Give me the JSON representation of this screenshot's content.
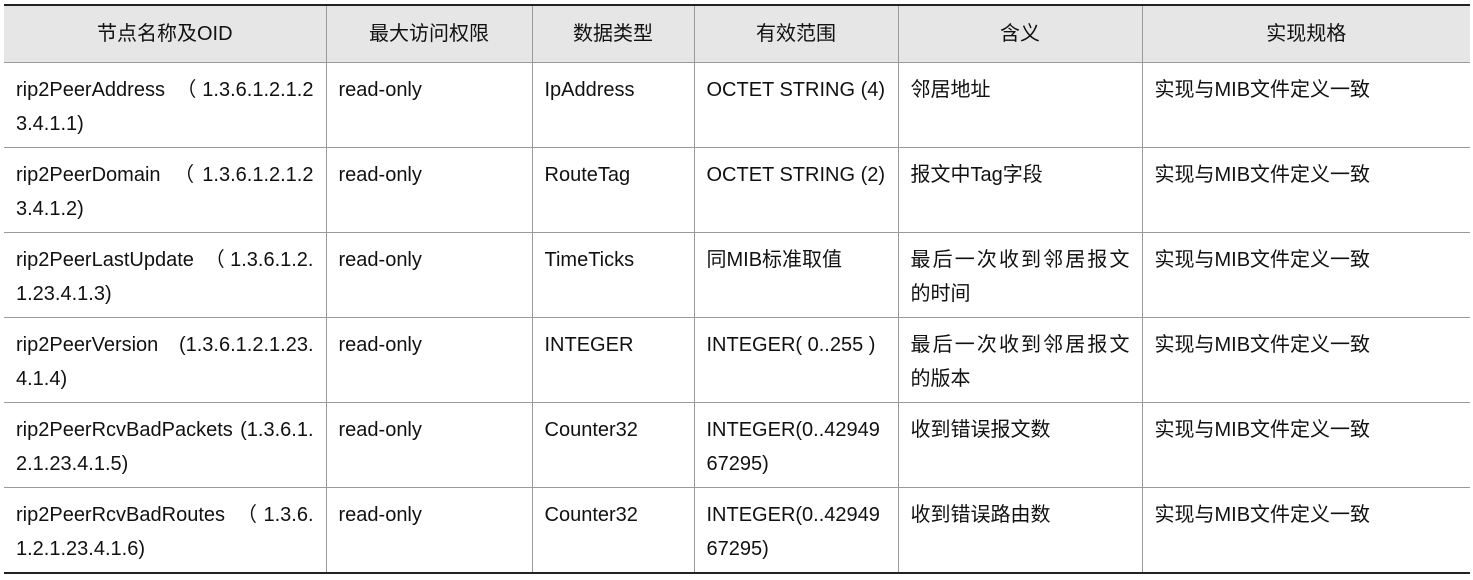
{
  "table": {
    "headers": [
      "节点名称及OID",
      "最大访问权限",
      "数据类型",
      "有效范围",
      "含义",
      "实现规格"
    ],
    "rows": [
      [
        "rip2PeerAddress （1.3.6.1.2.1.23.4.1.1)",
        "read-only",
        "IpAddress",
        "OCTET STRING (4)",
        "邻居地址",
        "实现与MIB文件定义一致"
      ],
      [
        "rip2PeerDomain （1.3.6.1.2.1.23.4.1.2)",
        "read-only",
        "RouteTag",
        "OCTET STRING (2)",
        "报文中Tag字段",
        "实现与MIB文件定义一致"
      ],
      [
        "rip2PeerLastUpdate （1.3.6.1.2.1.23.4.1.3)",
        "read-only",
        "TimeTicks",
        "同MIB标准取值",
        "最后一次收到邻居报文的时间",
        "实现与MIB文件定义一致"
      ],
      [
        "rip2PeerVersion (1.3.6.1.2.1.23.4.1.4)",
        "read-only",
        "INTEGER",
        "INTEGER( 0..255 )",
        "最后一次收到邻居报文的版本",
        "实现与MIB文件定义一致"
      ],
      [
        "rip2PeerRcvBadPackets (1.3.6.1.2.1.23.4.1.5)",
        "read-only",
        "Counter32",
        "INTEGER(0..4294967295)",
        "收到错误报文数",
        "实现与MIB文件定义一致"
      ],
      [
        "rip2PeerRcvBadRoutes （1.3.6.1.2.1.23.4.1.6)",
        "read-only",
        "Counter32",
        "INTEGER(0..4294967295)",
        "收到错误路由数",
        "实现与MIB文件定义一致"
      ]
    ]
  }
}
